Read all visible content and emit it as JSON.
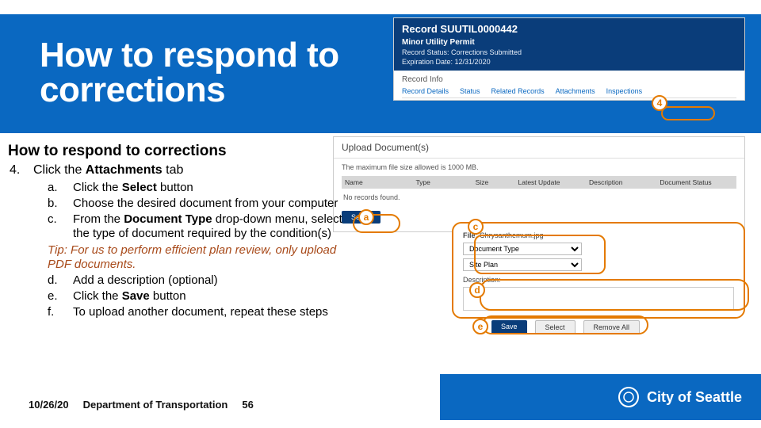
{
  "banner": {
    "title1": "How to respond to",
    "title2": "corrections"
  },
  "left": {
    "heading": "How to respond to corrections",
    "step_num": "4.",
    "step_text_pre": "Click the ",
    "step_text_bold": "Attachments",
    "step_text_post": " tab",
    "a_label": "a.",
    "a_pre": "Click the ",
    "a_bold": "Select",
    "a_post": " button",
    "b_label": "b.",
    "b_text": "Choose the desired document from your computer",
    "c_label": "c.",
    "c_pre": "From the ",
    "c_bold": "Document Type",
    "c_post": " drop-down menu, select the type of document required by the condition(s)",
    "tip": "Tip: For us to perform efficient plan review, only upload PDF documents.",
    "d_label": "d.",
    "d_text": "Add a description (optional)",
    "e_label": "e.",
    "e_pre": "Click the ",
    "e_bold": "Save",
    "e_post": " button",
    "f_label": "f.",
    "f_text": "To upload another document, repeat these steps"
  },
  "record": {
    "number": "Record SUUTIL0000442",
    "type": "Minor Utility Permit",
    "status": "Record Status: Corrections Submitted",
    "exp": "Expiration Date: 12/31/2020",
    "infolabel": "Record Info",
    "tabs": [
      "Record Details",
      "Status",
      "Related Records",
      "Attachments",
      "Inspections"
    ]
  },
  "upload": {
    "title": "Upload Document(s)",
    "max": "The maximum file size allowed is 1000 MB.",
    "cols": [
      "Name",
      "Type",
      "Size",
      "Latest Update",
      "Description",
      "Document Status"
    ],
    "norec": "No records found.",
    "select": "Select"
  },
  "file": {
    "label": "File:",
    "filename": "Chrysanthemum.jpg",
    "options": [
      "Document Type",
      "Site Plan"
    ],
    "desc_label": "Description:"
  },
  "buttons": {
    "save": "Save",
    "select": "Select",
    "remove": "Remove All"
  },
  "badges": {
    "b4": "4",
    "a": "a",
    "c": "c",
    "d": "d",
    "e": "e"
  },
  "footer": {
    "date": "10/26/20",
    "org": "Department of Transportation",
    "page": "56",
    "logo": "City of Seattle"
  }
}
